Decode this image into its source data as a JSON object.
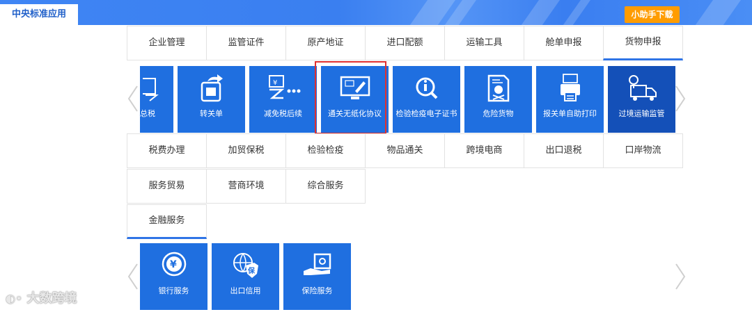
{
  "header": {
    "app_tab": "中央标准应用",
    "download_button": "小助手下载"
  },
  "category_rows": {
    "row1": [
      "企业管理",
      "监管证件",
      "原产地证",
      "进口配额",
      "运输工具",
      "舱单申报",
      "货物申报"
    ],
    "row2": [
      "税费办理",
      "加贸保税",
      "检验检疫",
      "物品通关",
      "跨境电商",
      "出口退税",
      "口岸物流"
    ],
    "row3": [
      "服务贸易",
      "营商环境",
      "综合服务"
    ],
    "row4": [
      "金融服务"
    ]
  },
  "cargo_tiles": [
    {
      "label": "总税",
      "icon": "tax-icon"
    },
    {
      "label": "转关单",
      "icon": "transfer-document-icon"
    },
    {
      "label": "减免税后续",
      "icon": "tax-reduction-icon"
    },
    {
      "label": "通关无纸化协议",
      "icon": "paperless-monitor-icon"
    },
    {
      "label": "检验检疫电子证书",
      "icon": "inspection-certificate-icon"
    },
    {
      "label": "危险货物",
      "icon": "dangerous-goods-icon"
    },
    {
      "label": "报关单自助打印",
      "icon": "printer-icon"
    },
    {
      "label": "过境运输监管",
      "icon": "transit-truck-icon"
    }
  ],
  "finance_tiles": [
    {
      "label": "银行服务",
      "icon": "bank-yen-icon"
    },
    {
      "label": "出口信用",
      "icon": "export-credit-icon"
    },
    {
      "label": "保险服务",
      "icon": "insurance-safe-icon"
    }
  ],
  "watermark": "大数跨境",
  "colors": {
    "topbar": "#3a7ff0",
    "tile": "#1f6fe0",
    "tile_active": "#1450b8",
    "download": "#ff9c00",
    "highlight": "#e0302f",
    "active_underline": "#2f74e6"
  }
}
